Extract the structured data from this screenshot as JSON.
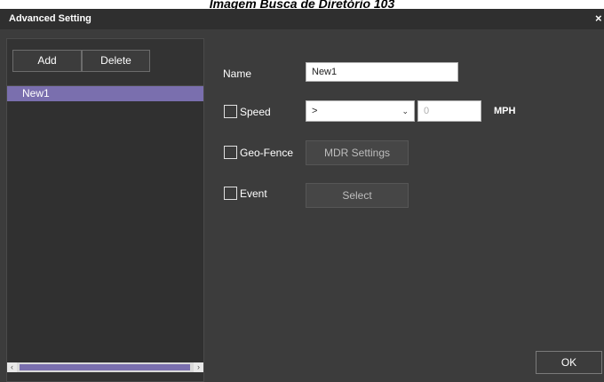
{
  "caption": "Imagem Busca de Diretório 103",
  "window": {
    "title": "Advanced Setting",
    "close_icon": "close-icon",
    "close_glyph": "×"
  },
  "left_panel": {
    "add_label": "Add",
    "delete_label": "Delete",
    "list_items": [
      "New1"
    ],
    "selected_index": 0
  },
  "form": {
    "name_label": "Name",
    "name_value": "New1",
    "speed_label": "Speed",
    "speed_checked": false,
    "speed_operator": ">",
    "speed_value_placeholder": "0",
    "speed_unit": "MPH",
    "geofence_label": "Geo-Fence",
    "geofence_checked": false,
    "mdr_settings_label": "MDR Settings",
    "event_label": "Event",
    "event_checked": false,
    "select_label": "Select"
  },
  "footer": {
    "ok_label": "OK"
  },
  "colors": {
    "background": "#3c3c3c",
    "titlebar": "#2f2f2f",
    "selection": "#7a6fae",
    "text": "#ffffff"
  }
}
